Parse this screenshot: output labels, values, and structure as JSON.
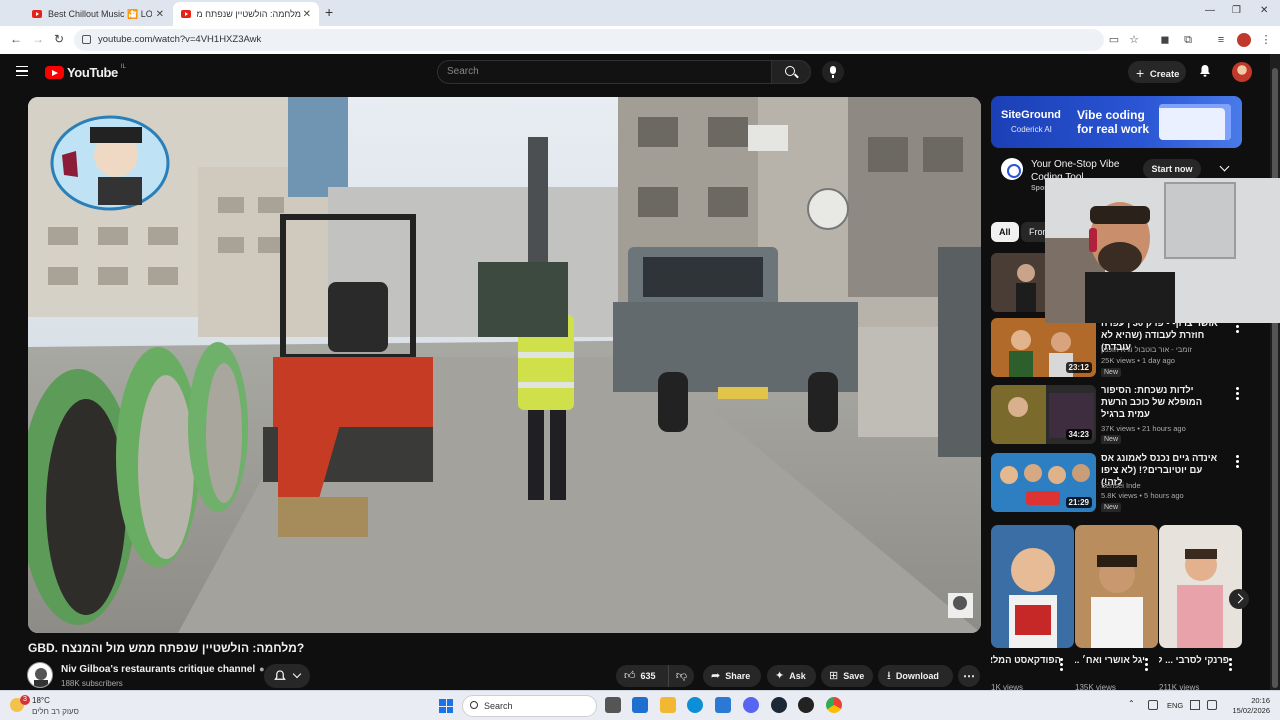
{
  "browser": {
    "tabs": [
      {
        "title": "Best Chillout Music 🎦 LOUNGE",
        "active": false
      },
      {
        "title": "מלחמה: הולשטיין שנפתח מ",
        "active": true
      }
    ],
    "url": "youtube.com/watch?v=4VH1HXZ3Awk"
  },
  "youtube": {
    "logo_text": "YouTube",
    "country_code": "IL",
    "search_placeholder": "Search",
    "create_label": "Create"
  },
  "video": {
    "title": "GBD. מלחמה: הולשטיין שנפתח ממש מול והמנצח?",
    "channel_name": "Niv Gilboa's restaurants critique channel",
    "subscribers": "188K subscribers",
    "likes": "635",
    "actions": {
      "share": "Share",
      "ask": "Ask",
      "save": "Save",
      "download": "Download"
    }
  },
  "ad": {
    "brand": "SiteGround",
    "brand_sub": "Coderick AI",
    "tagline": "Vibe coding\nfor real work",
    "title": "Your One-Stop Vibe\nCoding Tool",
    "sponsored": "Spon",
    "cta": "Start now"
  },
  "chips": [
    "All",
    "From"
  ],
  "recommendations": [
    {
      "title": "אושר צרוף - פרק 30 | עפרה חוזרת לעבודה (שהיא לא עובדת)",
      "channel": "זומבי - אור בוטבול וגיא הוכמן",
      "meta": "25K views • 1 day ago",
      "duration": "23:12",
      "new": "New"
    },
    {
      "title": "ילדות נשכחת: הסיפור המופלא של כוכב הרשת עמית ברגיל",
      "channel": "",
      "meta": "37K views • 21 hours ago",
      "duration": "34:23",
      "new": "New"
    },
    {
      "title": "אינדה גיים נכנס לאמונג אס עם יוטיוברים?! (לא ציפו לזה!)",
      "channel": "Sensei Inde",
      "meta": "5.8K views • 5 hours ago",
      "duration": "21:29",
      "new": "New"
    }
  ],
  "shorts": [
    {
      "title": "הפודקאסט המלא בתיאור",
      "views": "1K views"
    },
    {
      "title": "יגל אושרי ואח׳ ... לירן אושרי",
      "views": "135K views"
    },
    {
      "title": "פרנקי לסרבי ... לערוץ בשבל",
      "views": "211K views"
    }
  ],
  "taskbar": {
    "temperature": "18°C",
    "condition": "סעוק רב חלים",
    "weather_badge": "3",
    "search_label": "Search",
    "language": "ENG",
    "time": "20:16",
    "date": "15/02/2026"
  },
  "colors": {
    "youtube_red": "#ff0000",
    "background": "#0f0f0f",
    "chip_active": "#f1f1f1",
    "ad_blue": "#2a55d4"
  }
}
